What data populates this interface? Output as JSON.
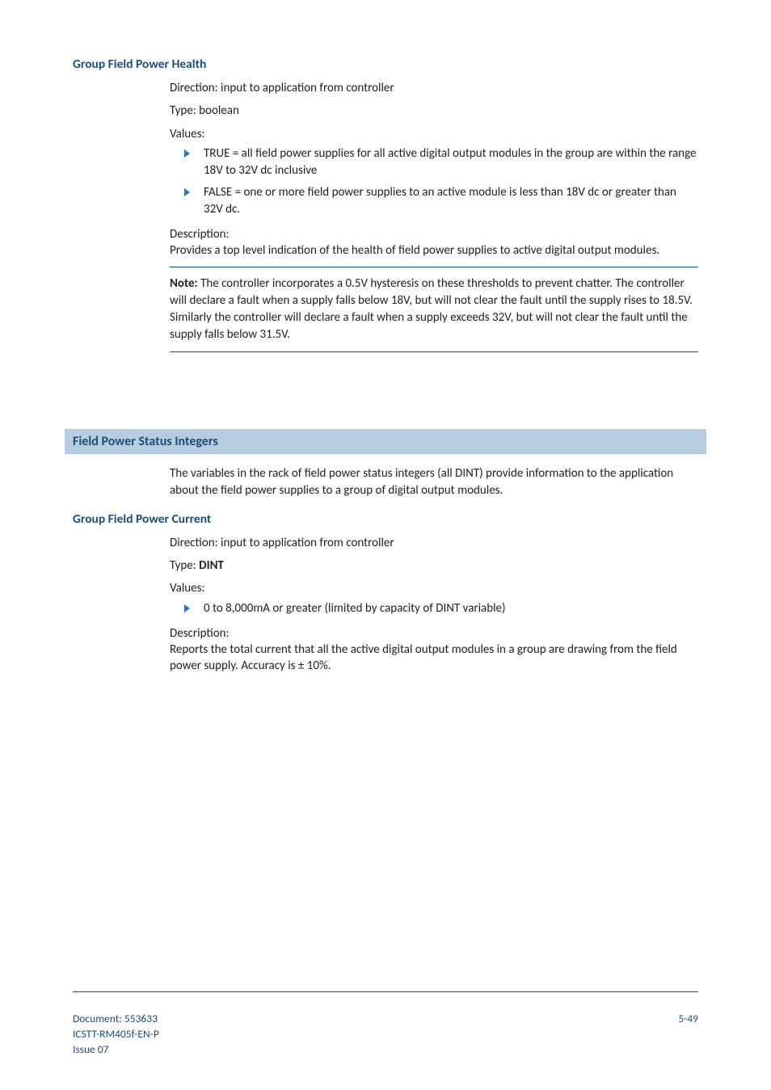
{
  "section1": {
    "heading": "Group Field Power Health",
    "direction": "Direction: input to application from controller",
    "type": "Type: boolean",
    "values_label": "Values:",
    "bullets": [
      "TRUE = all field power supplies for all active digital output modules in the group are within the range 18V to 32V dc inclusive",
      "FALSE = one or more field power supplies to an active module is less than 18V dc or greater than 32V dc."
    ],
    "desc_label": "Description:",
    "desc_body": "Provides a top level indication of the health of field power supplies to active digital output modules.",
    "note_label": "Note:",
    "note_body": " The controller incorporates a 0.5V hysteresis on these thresholds to prevent chatter. The controller will declare a fault when a supply falls below 18V, but will not clear the fault until the supply rises to 18.5V. Similarly the controller will declare a fault when a supply exceeds 32V, but will not clear the fault until the supply falls below 31.5V."
  },
  "section2": {
    "bar_title": "Field Power Status Integers",
    "intro": "The variables in the rack of field power status integers (all DINT) provide information to the application about the field power supplies to a group of digital output modules."
  },
  "section3": {
    "heading": "Group Field Power Current",
    "direction": "Direction: input to application from controller",
    "type_prefix": "Type: ",
    "type_value": "DINT",
    "values_label": "Values:",
    "bullets": [
      "0 to 8,000mA or greater (limited by capacity of DINT variable)"
    ],
    "desc_label": "Description:",
    "desc_body": "Reports the total current that all the active digital output modules in a group are drawing from the field power supply. Accuracy is ± 10%."
  },
  "footer": {
    "doc_line1": "Document: 553633",
    "doc_line2": "ICSTT-RM405f-EN-P",
    "doc_line3": " Issue 07",
    "page": "5-49"
  }
}
